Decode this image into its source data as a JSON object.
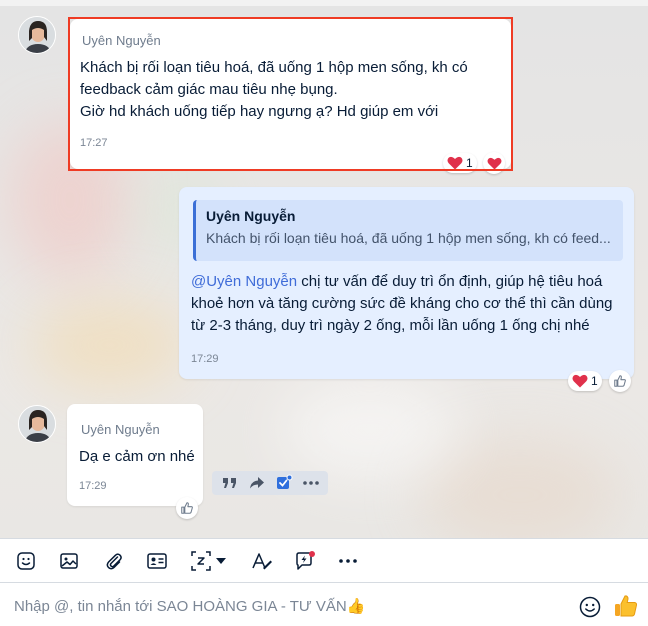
{
  "colors": {
    "accent": "#3f6cd8",
    "highlight_frame": "#ef3b24",
    "own_bubble": "#e5efff",
    "quote_bg": "#d3e2fb",
    "heart": "#e0314b"
  },
  "messages": [
    {
      "sender": "Uyên Nguyễn",
      "lines": [
        "Khách bị rối loạn tiêu hoá, đã uống 1 hộp men sống, kh có",
        "feedback cảm giác mau tiêu nhẹ bụng.",
        "Giờ hd khách uống tiếp hay ngưng ạ? Hd giúp em với"
      ],
      "time": "17:27",
      "reactions": {
        "heart_count": "1"
      }
    },
    {
      "quote": {
        "name": "Uyên Nguyễn",
        "text": "Khách bị rối loạn tiêu hoá, đã uống 1 hộp men sống, kh có feed..."
      },
      "mention": "@Uyên Nguyễn",
      "line1_rest": " chị tư vấn để duy trì ổn định, giúp hệ tiêu hoá",
      "line2": "khoẻ hơn và tăng cường sức đề kháng cho cơ thể thì cần dùng",
      "line3": "từ 2-3 tháng, duy trì ngày 2 ống, mỗi lần uống 1 ống chị nhé",
      "time": "17:29",
      "reactions": {
        "heart_count": "1"
      }
    },
    {
      "sender": "Uyên Nguyễn",
      "text": "Dạ e cảm ơn nhé",
      "time": "17:29"
    }
  ],
  "toolbar": {
    "icons": [
      "sticker-icon",
      "image-icon",
      "attachment-icon",
      "contact-card-icon",
      "screenshot-icon",
      "chevron-down-icon",
      "text-format-icon",
      "quick-message-icon",
      "more-icon"
    ]
  },
  "composer": {
    "placeholder": "Nhập @, tin nhắn tới SAO HOÀNG GIA - TƯ VẤN👍"
  }
}
